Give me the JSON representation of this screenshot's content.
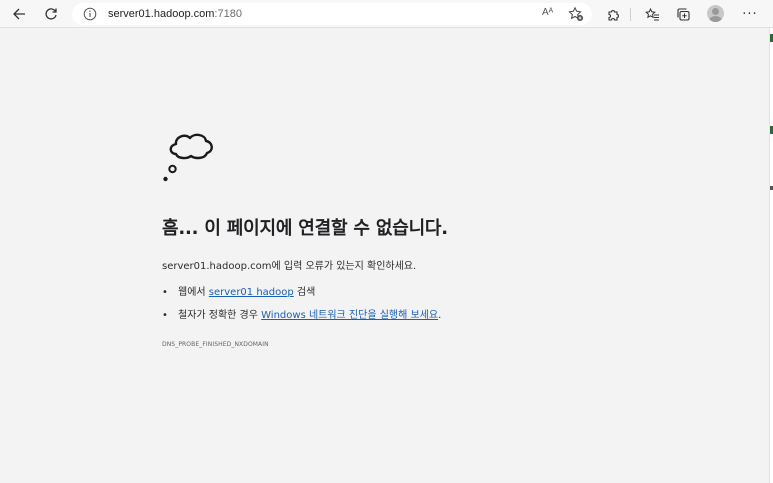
{
  "browser": {
    "address": {
      "host": "server01.hadoop.com",
      "port": ":7180"
    },
    "read_aloud_label": "Aᴬ",
    "more_label": "···"
  },
  "error_page": {
    "title": "흠... 이 페이지에 연결할 수 없습니다.",
    "message": "server01.hadoop.com에 입력 오류가 있는지 확인하세요.",
    "bullet": "•",
    "suggestion1": {
      "prefix": "웹에서 ",
      "link": "server01 hadoop",
      "suffix": " 검색"
    },
    "suggestion2": {
      "prefix": "철자가 정확한 경우 ",
      "link": "Windows 네트워크 진단을 실행해 보세요",
      "suffix": "."
    },
    "error_code": "DNS_PROBE_FINISHED_NXDOMAIN"
  },
  "colors": {
    "link": "#1a5fb4",
    "background": "#f3f3f3"
  }
}
